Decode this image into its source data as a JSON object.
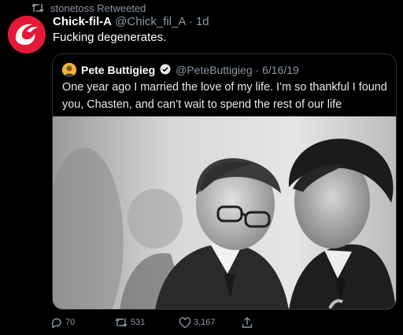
{
  "retweet": {
    "text": "stonetoss Retweeted"
  },
  "tweet": {
    "name": "Chick-fil-A",
    "handle": "@Chick_fil_A",
    "separator": " · ",
    "time": "1d",
    "text": "Fucking degenerates.",
    "brand_color": "#e51937"
  },
  "quoted": {
    "name": "Pete Buttigieg",
    "handle": "@PeteButtigieg",
    "separator": " · ",
    "date": "6/16/19",
    "text": "One year ago I married the love of my life. I’m so thankful I found you, Chasten, and can’t wait to spend the rest of our life together.",
    "verified_color": "#e7e9ea",
    "photo_icon": "photo"
  },
  "actions": {
    "replies": "70",
    "retweets": "531",
    "likes": "3,167",
    "retweet_color": "#8b98a5"
  }
}
